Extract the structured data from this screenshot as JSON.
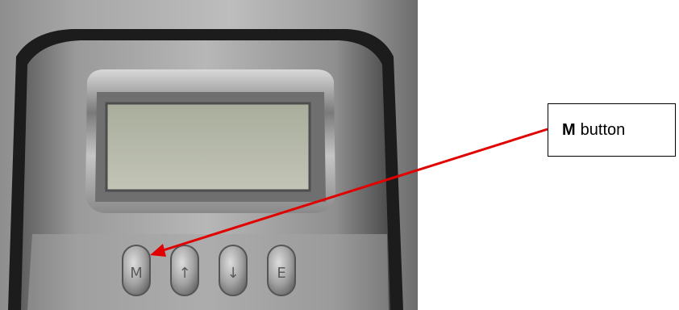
{
  "callout": {
    "bold_text": "M",
    "text": "button"
  },
  "keypad": {
    "buttons": [
      {
        "glyph": "M",
        "icon": "m-key"
      },
      {
        "glyph": "↑",
        "icon": "up-arrow-icon"
      },
      {
        "glyph": "↓",
        "icon": "down-arrow-icon"
      },
      {
        "glyph": "E",
        "icon": "e-key"
      }
    ]
  },
  "colors": {
    "arrow": "#e00000",
    "lcd": "#b9bcad"
  }
}
